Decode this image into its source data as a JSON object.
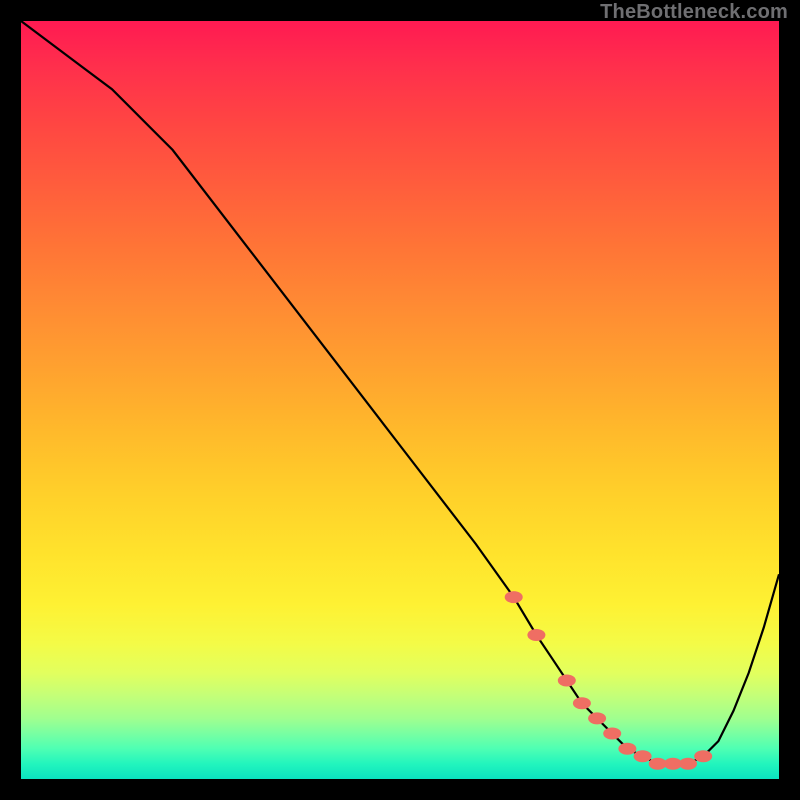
{
  "watermark": "TheBottleneck.com",
  "chart_data": {
    "type": "line",
    "title": "",
    "xlabel": "",
    "ylabel": "",
    "xlim": [
      0,
      100
    ],
    "ylim": [
      0,
      100
    ],
    "series": [
      {
        "name": "bottleneck-curve",
        "x": [
          0,
          4,
          8,
          12,
          20,
          30,
          40,
          50,
          60,
          65,
          68,
          70,
          72,
          74,
          76,
          78,
          80,
          82,
          84,
          86,
          88,
          90,
          92,
          94,
          96,
          98,
          100
        ],
        "values": [
          100,
          97,
          94,
          91,
          83,
          70,
          57,
          44,
          31,
          24,
          19,
          16,
          13,
          10,
          8,
          6,
          4,
          3,
          2,
          2,
          2,
          3,
          5,
          9,
          14,
          20,
          27
        ]
      }
    ],
    "markers": {
      "name": "highlighted-points",
      "x": [
        65,
        68,
        72,
        74,
        76,
        78,
        80,
        82,
        84,
        86,
        88,
        90
      ],
      "values": [
        24,
        19,
        13,
        10,
        8,
        6,
        4,
        3,
        2,
        2,
        2,
        3
      ]
    },
    "background_gradient": {
      "stops": [
        {
          "pos": 0.0,
          "color": "#ff1a52"
        },
        {
          "pos": 0.5,
          "color": "#ffb92b"
        },
        {
          "pos": 0.82,
          "color": "#f4fb46"
        },
        {
          "pos": 1.0,
          "color": "#0be2c0"
        }
      ]
    }
  }
}
